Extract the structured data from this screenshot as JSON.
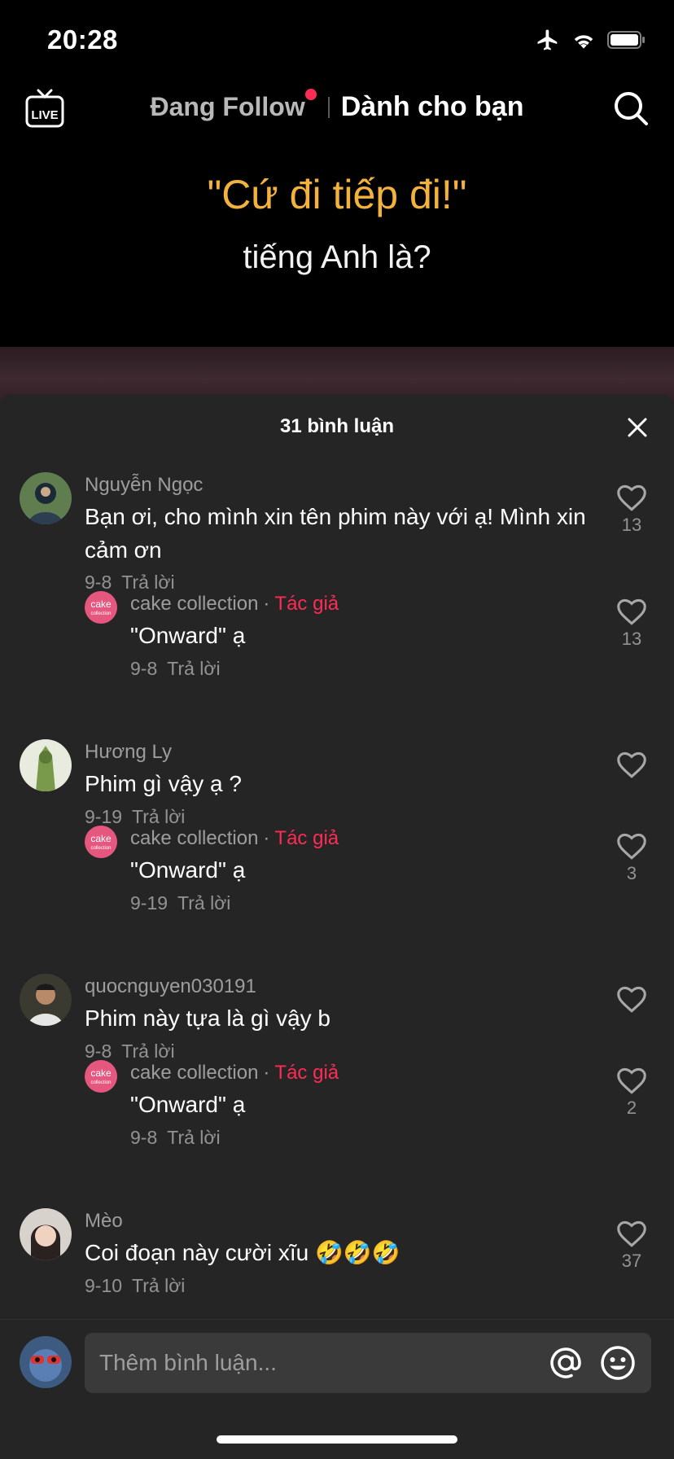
{
  "status_bar": {
    "time": "20:28"
  },
  "nav": {
    "following_label": "Đang Follow",
    "for_you_label": "Dành cho bạn"
  },
  "video": {
    "title": "\"Cứ đi tiếp đi!\"",
    "subtitle": "tiếng Anh là?"
  },
  "sheet": {
    "title": "31 bình luận"
  },
  "reply_label": "Trả lời",
  "creator_label": "Tác giả",
  "comments": [
    {
      "author": "Nguyễn Ngọc",
      "text": "Bạn ơi, cho mình xin tên phim này với ạ! Mình xin cảm ơn",
      "date": "9-8",
      "likes": "13",
      "reply": false
    },
    {
      "author": "cake collection",
      "text": "\"Onward\" ạ",
      "date": "9-8",
      "likes": "13",
      "reply": true
    },
    {
      "author": "Hương Ly",
      "text": "Phim gì vậy ạ ?",
      "date": "9-19",
      "likes": "",
      "reply": false
    },
    {
      "author": "cake collection",
      "text": "\"Onward\" ạ",
      "date": "9-19",
      "likes": "3",
      "reply": true
    },
    {
      "author": "quocnguyen030191",
      "text": "Phim này tựa là gì vậy b",
      "date": "9-8",
      "likes": "",
      "reply": false
    },
    {
      "author": "cake collection",
      "text": "\"Onward\" ạ",
      "date": "9-8",
      "likes": "2",
      "reply": true
    },
    {
      "author": "Mèo",
      "text": "Coi đoạn này cười xĩu 🤣🤣🤣",
      "date": "9-10",
      "likes": "37",
      "reply": false
    }
  ],
  "input": {
    "placeholder": "Thêm bình luận..."
  },
  "colors": {
    "accent": "#fe2c55",
    "sheet_bg": "#252525",
    "video_title": "#f3b23b"
  }
}
